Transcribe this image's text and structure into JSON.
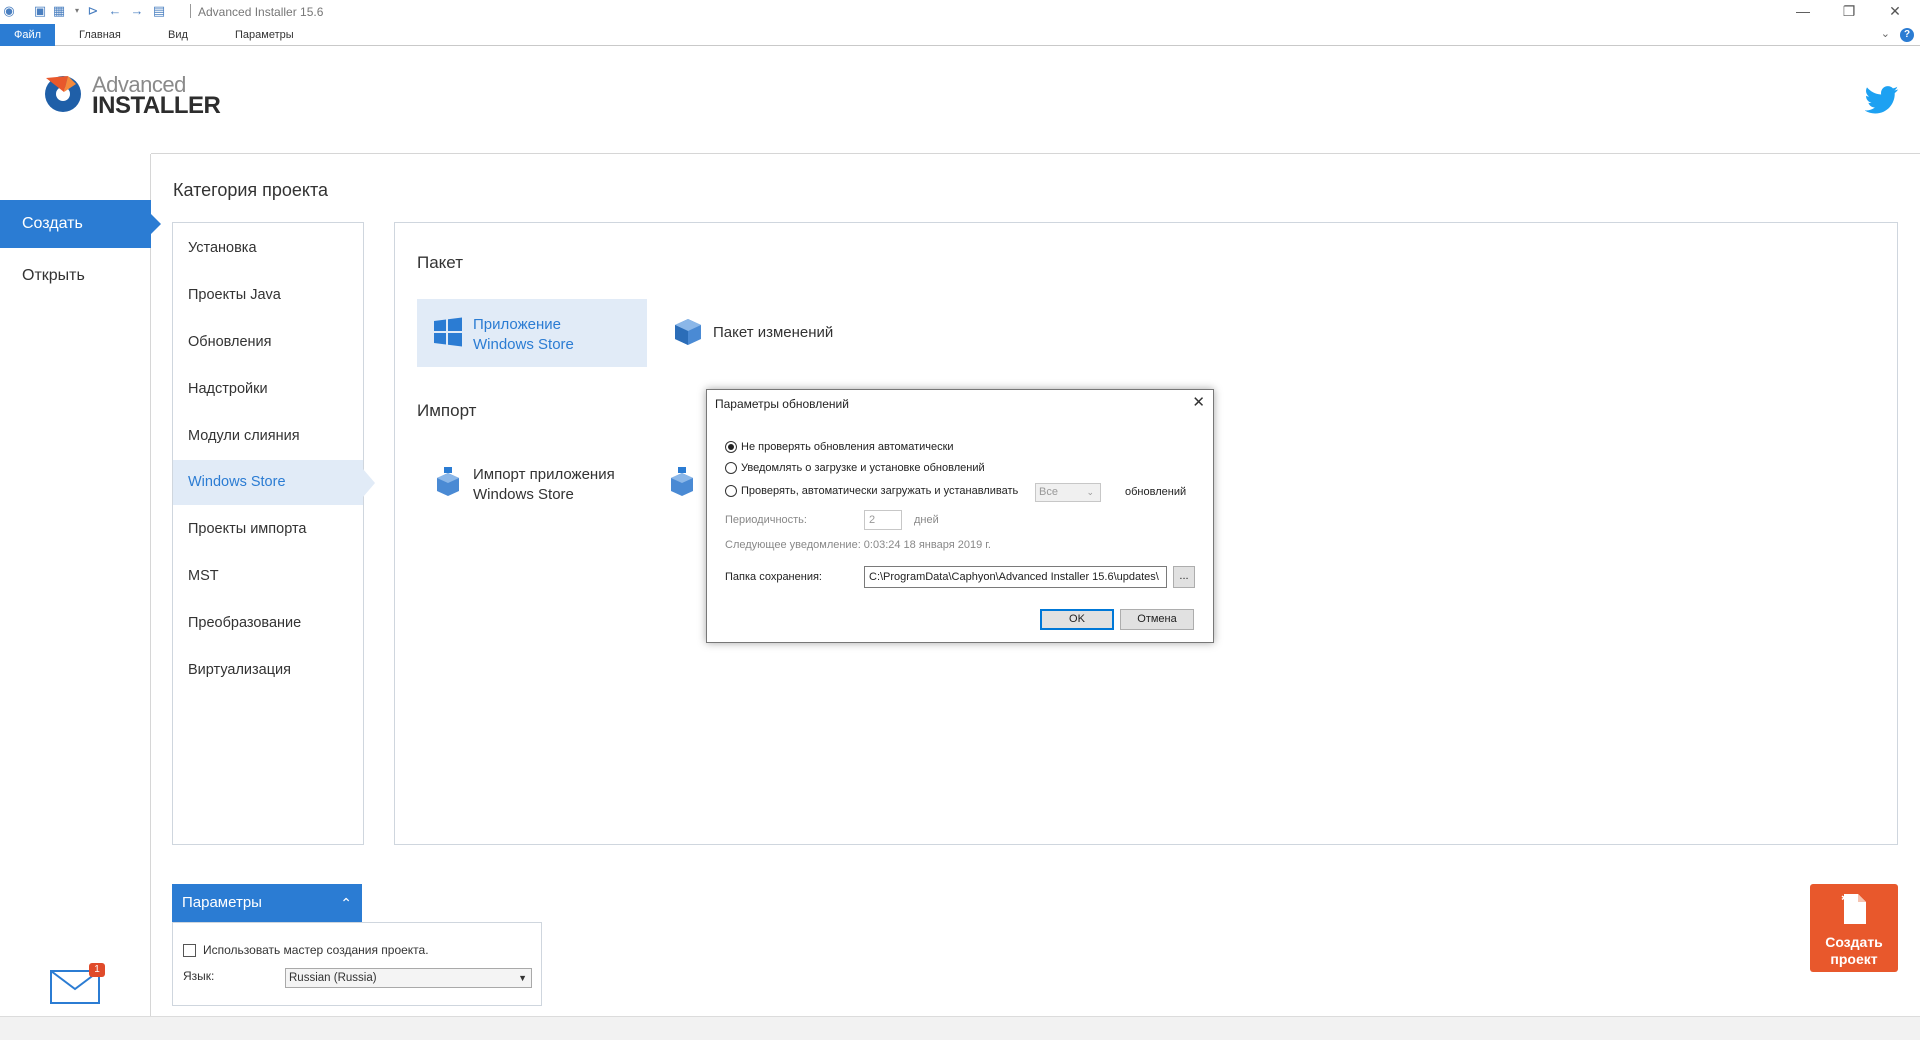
{
  "window": {
    "title": "Advanced Installer 15.6",
    "minimize": "—",
    "maximize": "❐",
    "close": "✕"
  },
  "ribbon": {
    "tabs": [
      {
        "label": "Файл",
        "active": true
      },
      {
        "label": "Главная",
        "active": false
      },
      {
        "label": "Вид",
        "active": false
      },
      {
        "label": "Параметры",
        "active": false
      }
    ],
    "help": "?",
    "collapse": "⌄"
  },
  "logo": {
    "line1": "Advanced",
    "line2": "INSTALLER"
  },
  "leftnav": {
    "items": [
      {
        "label": "Создать",
        "active": true
      },
      {
        "label": "Открыть",
        "active": false
      }
    ]
  },
  "main": {
    "category_title": "Категория проекта",
    "categories": [
      {
        "label": "Установка"
      },
      {
        "label": "Проекты Java"
      },
      {
        "label": "Обновления"
      },
      {
        "label": "Надстройки"
      },
      {
        "label": "Модули слияния"
      },
      {
        "label": "Windows Store"
      },
      {
        "label": "Проекты импорта"
      },
      {
        "label": "MST"
      },
      {
        "label": "Преобразование"
      },
      {
        "label": "Виртуализация"
      }
    ],
    "sections": {
      "package_title": "Пакет",
      "import_title": "Импорт",
      "package_tiles": [
        {
          "line1": "Приложение",
          "line2": "Windows Store",
          "icon": "windows-logo-icon"
        },
        {
          "line1": "Пакет изменений",
          "line2": "",
          "icon": "package-box-icon"
        }
      ],
      "import_tiles": [
        {
          "line1": "Импорт приложения",
          "line2": "Windows Store",
          "icon": "windows-import-icon"
        }
      ]
    }
  },
  "params": {
    "header": "Параметры",
    "wizard_label": "Использовать мастер создания проекта.",
    "lang_label": "Язык:",
    "lang_value": "Russian (Russia)"
  },
  "mail": {
    "badge": "1"
  },
  "create_button": {
    "line1": "Создать",
    "line2": "проект"
  },
  "dialog": {
    "title": "Параметры обновлений",
    "options": [
      {
        "label": "Не проверять обновления автоматически",
        "checked": true
      },
      {
        "label": "Уведомлять о загрузке и установке обновлений",
        "checked": false
      },
      {
        "label": "Проверять, автоматически загружать и устанавливать",
        "checked": false
      }
    ],
    "frequency_value": "Все",
    "frequency_suffix": "обновлений",
    "period_label": "Периодичность:",
    "period_value": "2",
    "period_unit": "дней",
    "next_notice": "Следующее уведомление: 0:03:24 18 января 2019 г.",
    "folder_label": "Папка сохранения:",
    "folder_value": "C:\\ProgramData\\Caphyon\\Advanced Installer 15.6\\updates\\",
    "browse_label": "...",
    "ok_label": "OK",
    "cancel_label": "Отмена"
  },
  "colors": {
    "accent": "#2b7cd3",
    "accent_light": "#e1ebf7",
    "create_button": "#e8582c",
    "twitter": "#1da1f2"
  }
}
